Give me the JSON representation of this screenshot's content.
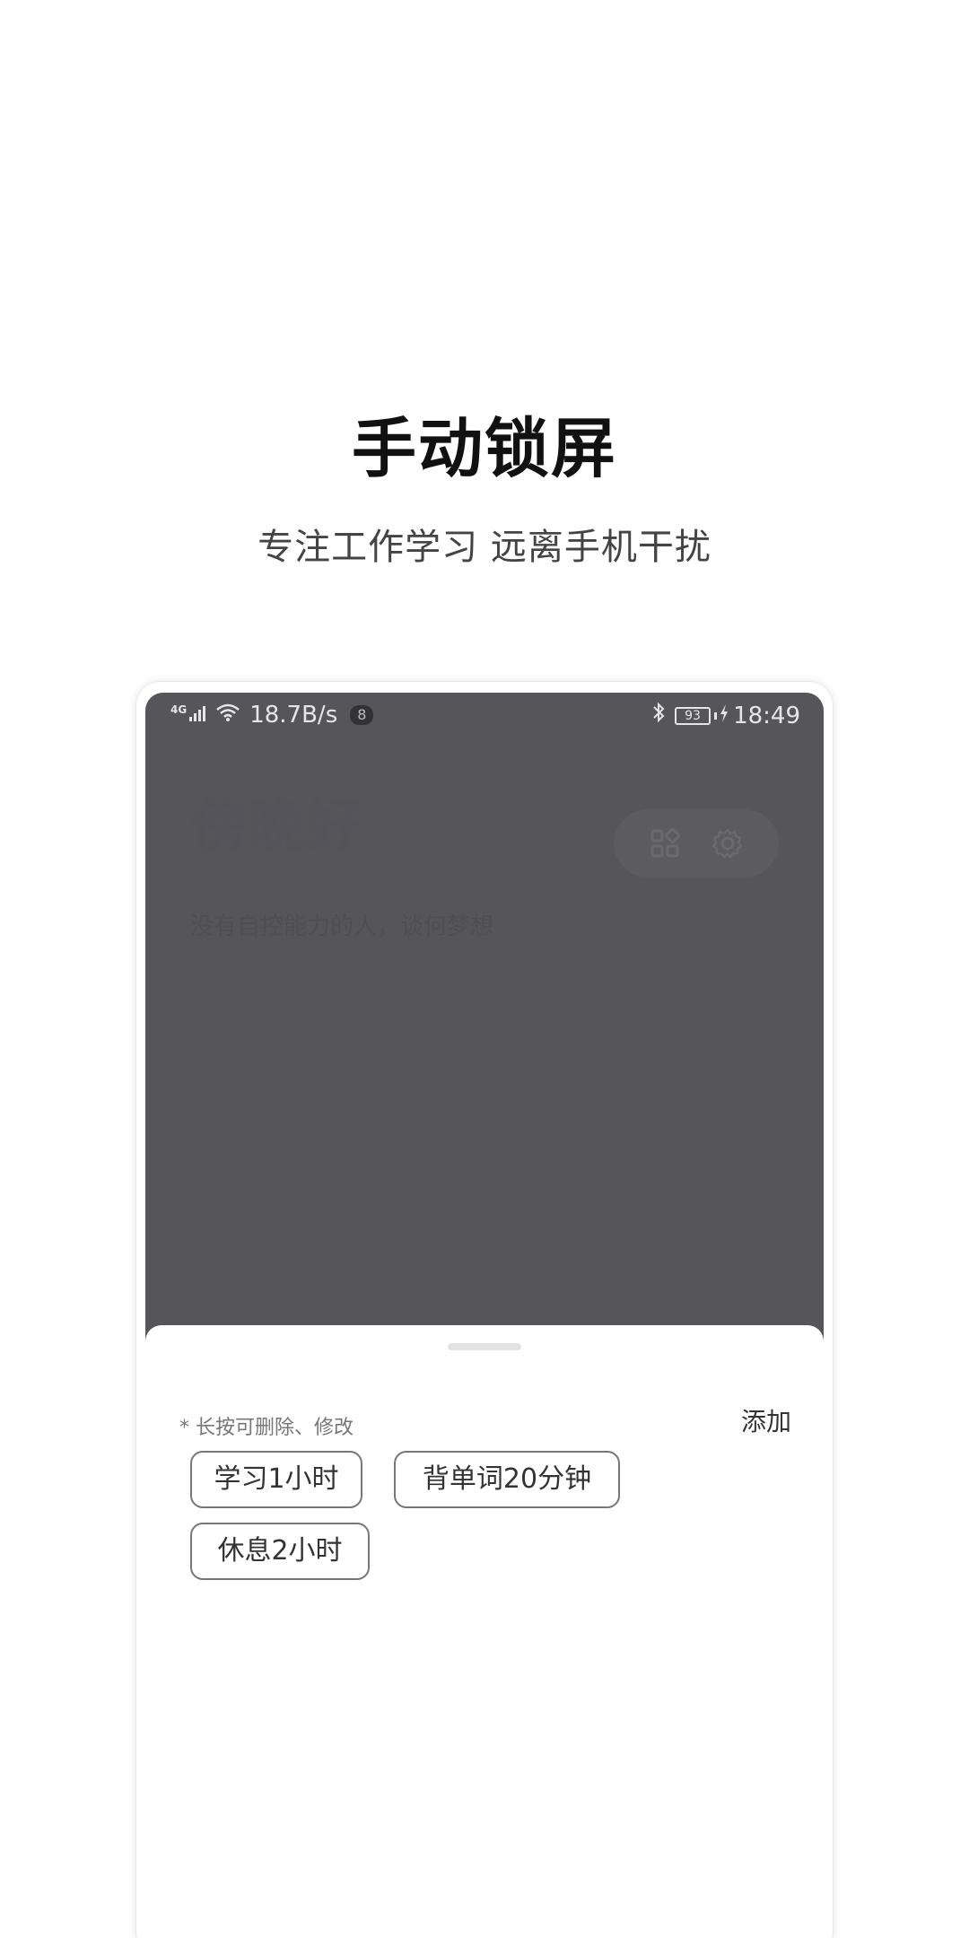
{
  "promo": {
    "title": "手动锁屏",
    "subtitle": "专注工作学习 远离手机干扰"
  },
  "status_bar": {
    "network_type": "4G",
    "speed": "18.7B/s",
    "notification_count": "8",
    "battery_level": "93",
    "time": "18:49"
  },
  "app": {
    "greeting": "傍晚好",
    "motto": "没有自控能力的人，谈何梦想",
    "icons": [
      "grid-icon",
      "settings-icon"
    ]
  },
  "sheet": {
    "hint": "* 长按可删除、修改",
    "add_label": "添加",
    "presets": [
      {
        "label": "学习1小时"
      },
      {
        "label": "背单词20分钟"
      },
      {
        "label": "休息2小时"
      }
    ]
  },
  "colors": {
    "overlay": "#56555a",
    "sheet_background": "#ffffff",
    "chip_border": "#777777",
    "title_text": "#111111"
  }
}
